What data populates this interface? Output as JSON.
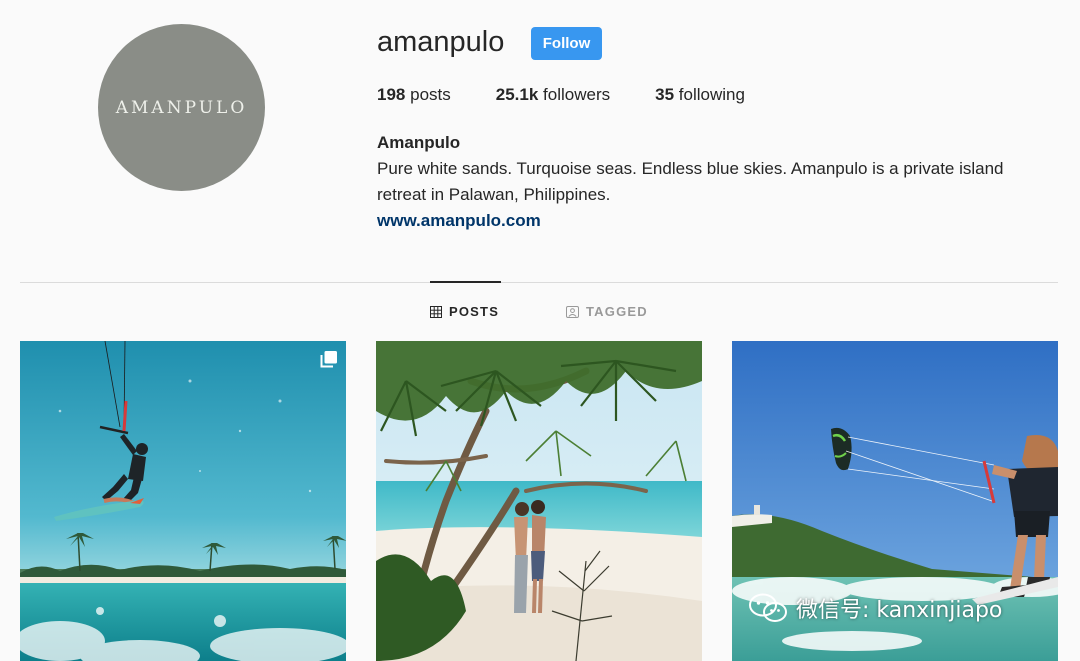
{
  "profile": {
    "avatar_text": "AMANPULO",
    "username": "amanpulo",
    "follow_label": "Follow",
    "stats": {
      "posts_count": "198",
      "posts_label": "posts",
      "followers_count": "25.1k",
      "followers_label": "followers",
      "following_count": "35",
      "following_label": "following"
    },
    "bio": {
      "name": "Amanpulo",
      "text": "Pure white sands. Turquoise seas. Endless blue skies. Amanpulo is a private island retreat in Palawan, Philippines.",
      "link": "www.amanpulo.com"
    }
  },
  "tabs": {
    "posts": "POSTS",
    "tagged": "TAGGED"
  },
  "colors": {
    "follow_button": "#3897f0",
    "link": "#003569",
    "background": "#fafafa",
    "avatar": "#8a8d87"
  },
  "watermark": {
    "text": "微信号: kanxinjiapo"
  }
}
